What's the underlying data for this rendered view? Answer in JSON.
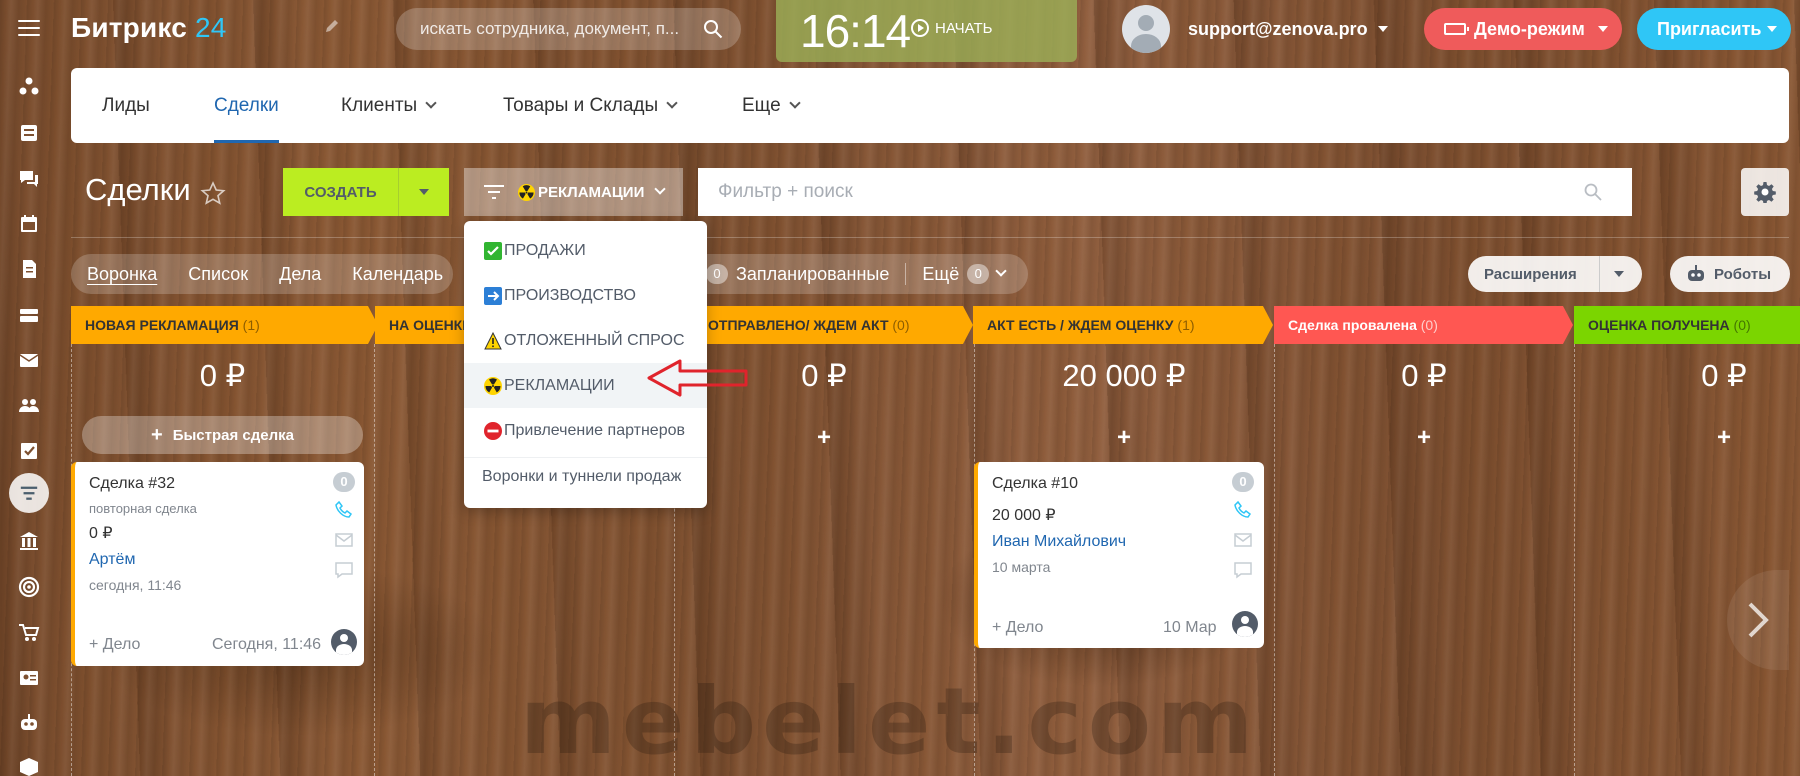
{
  "header": {
    "logo_text": "Битрикс",
    "logo_num": "24",
    "search_placeholder": "искать сотрудника, документ, п...",
    "clock": "16:14",
    "start_label": "НАЧАТЬ",
    "user_email": "support@zenova.pro",
    "demo_label": "Демо-режим",
    "invite_label": "Пригласить"
  },
  "nav": {
    "items": [
      "Лиды",
      "Сделки",
      "Клиенты",
      "Товары и Склады",
      "Еще"
    ],
    "active": "Сделки"
  },
  "toolbar": {
    "title": "Сделки",
    "create_label": "СОЗДАТЬ",
    "funnel_label": "РЕКЛАМАЦИИ",
    "filter_placeholder": "Фильтр + поиск"
  },
  "views": {
    "items": [
      "Воронка",
      "Список",
      "Дела",
      "Календарь"
    ],
    "active": "Воронка",
    "planned_count": "0",
    "planned_label": "Запланированные",
    "more_label": "Ещё",
    "more_count": "0",
    "extensions_label": "Расширения",
    "robots_label": "Роботы"
  },
  "stages": [
    {
      "name": "НОВАЯ РЕКЛАМАЦИЯ",
      "count": "(1)",
      "sum": "0 ₽",
      "color": "#ffa900"
    },
    {
      "name": "НА ОЦЕНКЕ",
      "count": "",
      "sum": "",
      "color": "#ffa900"
    },
    {
      "name": "ОТПРАВЛЕНО/ ЖДЕМ АКТ",
      "count": "(0)",
      "sum": "0 ₽",
      "color": "#ffa900"
    },
    {
      "name": "АКТ ЕСТЬ / ЖДЕМ ОЦЕНКУ",
      "count": "(1)",
      "sum": "20 000 ₽",
      "color": "#ffa900"
    },
    {
      "name": "Сделка провалена",
      "count": "(0)",
      "sum": "0 ₽",
      "color": "#ff5752"
    },
    {
      "name": "ОЦЕНКА ПОЛУЧЕНА",
      "count": "(0)",
      "sum": "0 ₽",
      "color": "#7bd500"
    }
  ],
  "quick_deal_label": "Быстрая сделка",
  "cards": [
    {
      "title": "Сделка #32",
      "subtitle": "повторная сделка",
      "amount": "0 ₽",
      "contact": "Артём",
      "date": "сегодня, 11:46",
      "badge": "0",
      "add_task": "+ Дело",
      "task_date": "Сегодня, 11:46"
    },
    {
      "title": "Сделка #10",
      "subtitle": "",
      "amount": "20 000 ₽",
      "contact": "Иван Михайлович",
      "date": "10 марта",
      "badge": "0",
      "add_task": "+ Дело",
      "task_date": "10 Мар"
    }
  ],
  "menu": {
    "items": [
      {
        "label": "ПРОДАЖИ",
        "icon": "check-mark-icon"
      },
      {
        "label": "ПРОИЗВОДСТВО",
        "icon": "right-arrow-icon"
      },
      {
        "label": "ОТЛОЖЕННЫЙ СПРОС",
        "icon": "warning-icon"
      },
      {
        "label": "РЕКЛАМАЦИИ",
        "icon": "radioactive-icon"
      },
      {
        "label": "Привлечение партнеров",
        "icon": "no-entry-icon"
      }
    ],
    "footer": "Воронки и туннели продаж"
  },
  "watermark": "mebelet.com"
}
